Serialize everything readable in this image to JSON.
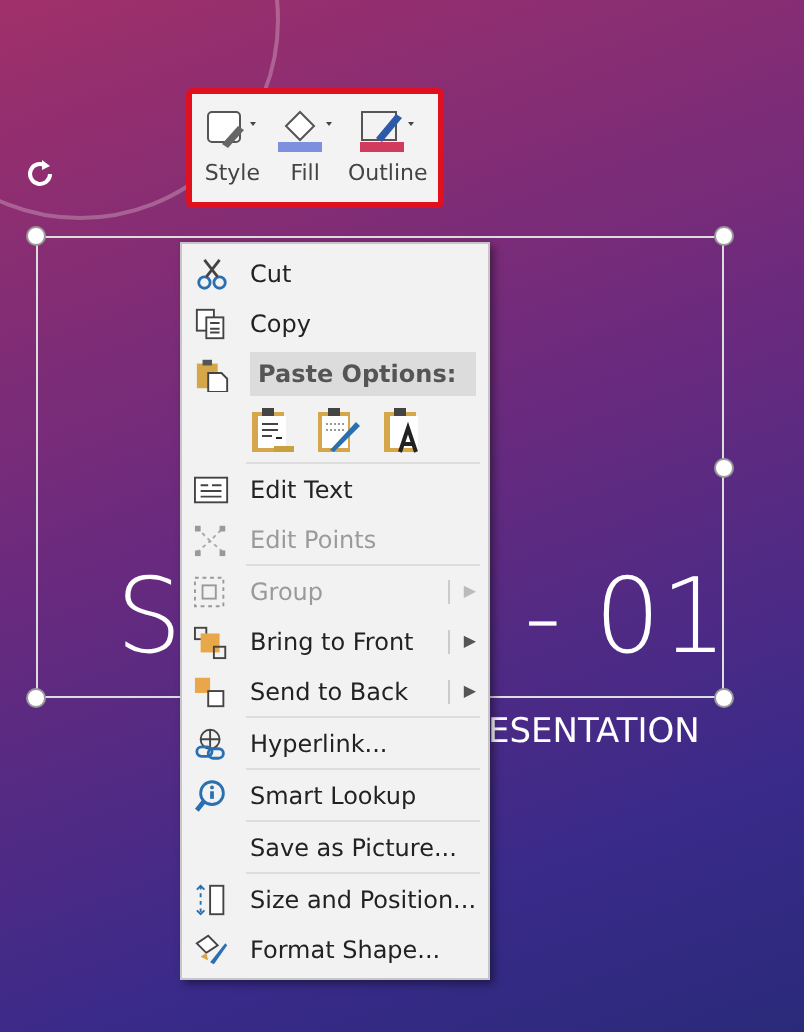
{
  "slide": {
    "title_left": "S",
    "title_right": "- 01",
    "subtitle": "ESENTATION"
  },
  "mini_toolbar": [
    {
      "label": "Style",
      "kind": "style"
    },
    {
      "label": "Fill",
      "kind": "fill"
    },
    {
      "label": "Outline",
      "kind": "outline"
    }
  ],
  "context_menu": [
    {
      "kind": "item",
      "label": "Cut",
      "disabled": false
    },
    {
      "kind": "item",
      "label": "Copy",
      "disabled": false
    },
    {
      "kind": "header",
      "label": "Paste Options:"
    },
    {
      "kind": "paste_options"
    },
    {
      "kind": "item",
      "label": "Edit Text",
      "disabled": false
    },
    {
      "kind": "item",
      "label": "Edit Points",
      "disabled": true
    },
    {
      "kind": "item",
      "label": "Group",
      "disabled": true,
      "arrow": "▶"
    },
    {
      "kind": "item",
      "label": "Bring to Front",
      "disabled": false,
      "arrow": "▶"
    },
    {
      "kind": "item",
      "label": "Send to Back",
      "disabled": false,
      "arrow": "▶"
    },
    {
      "kind": "item",
      "label": "Hyperlink...",
      "disabled": false
    },
    {
      "kind": "item",
      "label": "Smart Lookup",
      "disabled": false
    },
    {
      "kind": "item",
      "label": "Save as Picture...",
      "disabled": false
    },
    {
      "kind": "item",
      "label": "Size and Position...",
      "disabled": false
    },
    {
      "kind": "item",
      "label": "Format Shape...",
      "disabled": false
    }
  ]
}
